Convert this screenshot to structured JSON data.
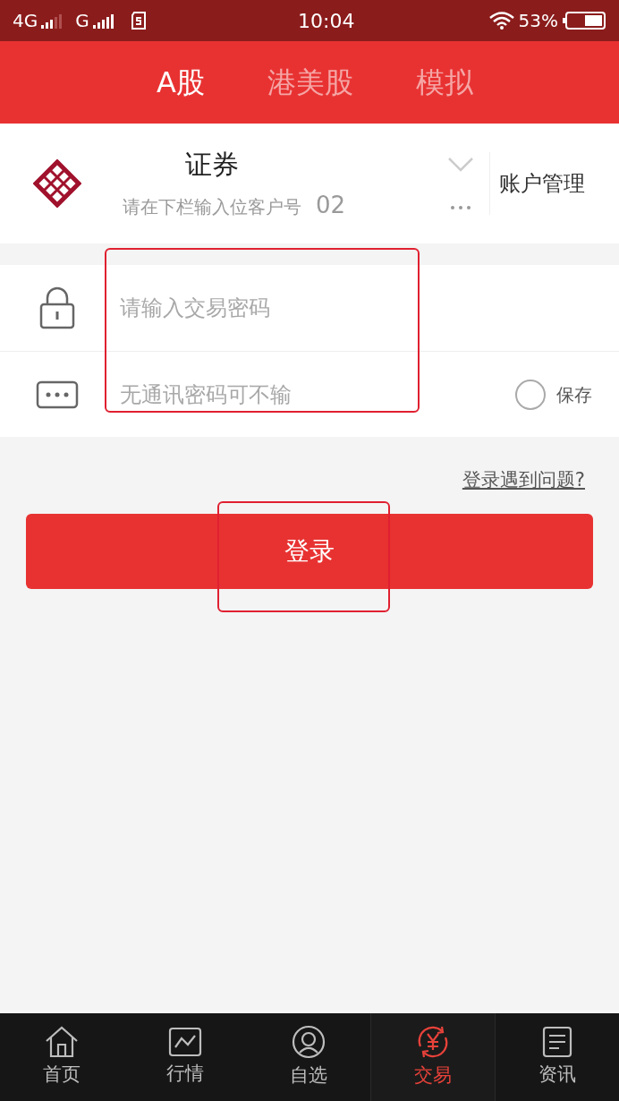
{
  "status_bar": {
    "network_1": "4G",
    "network_2": "G",
    "time": "10:04",
    "battery": "53%"
  },
  "tabs": [
    {
      "label": "A股",
      "selected": true
    },
    {
      "label": "港美股",
      "selected": false
    },
    {
      "label": "模拟",
      "selected": false
    }
  ],
  "account": {
    "name": "证券",
    "hint": "请在下栏输入位客户号",
    "number": "02",
    "manage_button": "账户管理"
  },
  "fields": [
    {
      "kind": "password",
      "placeholder": "请输入交易密码"
    },
    {
      "kind": "comm",
      "placeholder": "无通讯密码可不输",
      "save": {
        "label": "保存",
        "checked": false
      }
    }
  ],
  "help_link": "登录遇到问题?",
  "login_button": "登录",
  "nav": [
    {
      "label": "首页",
      "selected": false
    },
    {
      "label": "行情",
      "selected": false
    },
    {
      "label": "自选",
      "selected": false
    },
    {
      "label": "交易",
      "selected": true
    },
    {
      "label": "资讯",
      "selected": false
    }
  ]
}
